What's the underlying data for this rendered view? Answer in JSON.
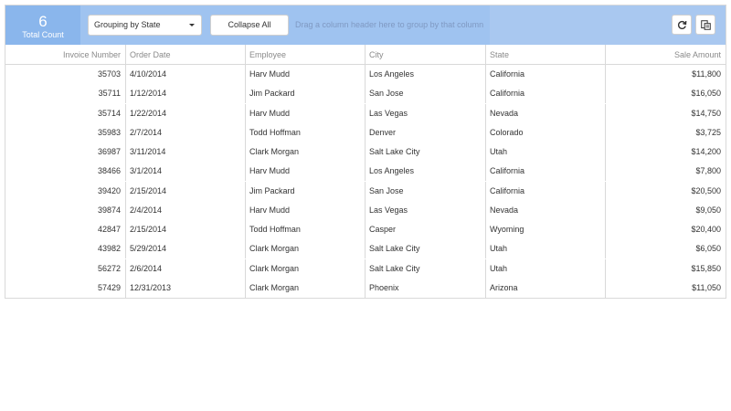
{
  "summary": {
    "count": "6",
    "count_label": "Total Count"
  },
  "toolbar": {
    "group_select": "Grouping by State",
    "collapse_label": "Collapse All",
    "drag_hint": "Drag a column header here to group by that column",
    "refresh_icon": "refresh-icon",
    "export_icon": "export-icon"
  },
  "columns": [
    "Invoice Number",
    "Order Date",
    "Employee",
    "City",
    "State",
    "Sale Amount"
  ],
  "rows": [
    [
      "35703",
      "4/10/2014",
      "Harv Mudd",
      "Los Angeles",
      "California",
      "$11,800"
    ],
    [
      "35711",
      "1/12/2014",
      "Jim Packard",
      "San Jose",
      "California",
      "$16,050"
    ],
    [
      "35714",
      "1/22/2014",
      "Harv Mudd",
      "Las Vegas",
      "Nevada",
      "$14,750"
    ],
    [
      "35983",
      "2/7/2014",
      "Todd Hoffman",
      "Denver",
      "Colorado",
      "$3,725"
    ],
    [
      "36987",
      "3/11/2014",
      "Clark Morgan",
      "Salt Lake City",
      "Utah",
      "$14,200"
    ],
    [
      "38466",
      "3/1/2014",
      "Harv Mudd",
      "Los Angeles",
      "California",
      "$7,800"
    ],
    [
      "39420",
      "2/15/2014",
      "Jim Packard",
      "San Jose",
      "California",
      "$20,500"
    ],
    [
      "39874",
      "2/4/2014",
      "Harv Mudd",
      "Las Vegas",
      "Nevada",
      "$9,050"
    ],
    [
      "42847",
      "2/15/2014",
      "Todd Hoffman",
      "Casper",
      "Wyoming",
      "$20,400"
    ],
    [
      "43982",
      "5/29/2014",
      "Clark Morgan",
      "Salt Lake City",
      "Utah",
      "$6,050"
    ],
    [
      "56272",
      "2/6/2014",
      "Clark Morgan",
      "Salt Lake City",
      "Utah",
      "$15,850"
    ],
    [
      "57429",
      "12/31/2013",
      "Clark Morgan",
      "Phoenix",
      "Arizona",
      "$11,050"
    ]
  ]
}
